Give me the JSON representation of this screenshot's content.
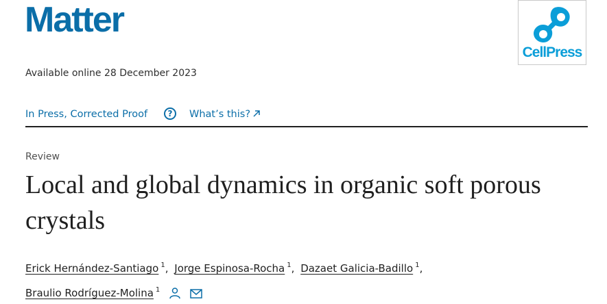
{
  "journal": {
    "title": "Matter"
  },
  "publisher": {
    "name": "CellPress",
    "brand_color": "#0b9ed8"
  },
  "article": {
    "available_online": "Available online 28 December 2023",
    "status": {
      "label": "In Press, Corrected Proof",
      "help_icon": "question-circle-icon",
      "whats_this": "What’s this?",
      "external_icon": "arrow-up-right-icon"
    },
    "type": "Review",
    "title": "Local and global dynamics in organic soft porous crystals",
    "authors": [
      {
        "name": "Erick Hernández-Santiago",
        "sup": "1"
      },
      {
        "name": "Jorge Espinosa-Rocha",
        "sup": "1"
      },
      {
        "name": "Dazaet Galicia-Badillo",
        "sup": "1"
      },
      {
        "name": "Braulio Rodríguez-Molina",
        "sup": "1",
        "icons": [
          "person-icon",
          "envelope-icon"
        ]
      }
    ],
    "separator": ","
  },
  "colors": {
    "link": "#0b6ea8",
    "text": "#1f1f1f"
  }
}
